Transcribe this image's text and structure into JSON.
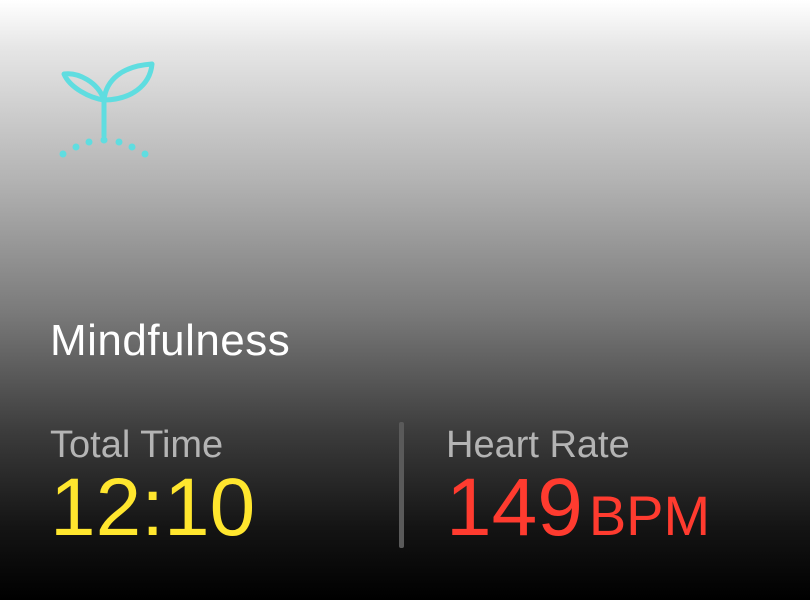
{
  "workout": {
    "icon": "sprout-icon",
    "icon_color": "#5fdde0",
    "title": "Mindfulness"
  },
  "metrics": {
    "total_time": {
      "label": "Total Time",
      "value": "12:10",
      "color": "#ffe62e"
    },
    "heart_rate": {
      "label": "Heart Rate",
      "value": "149",
      "unit": "BPM",
      "color": "#ff3b2f"
    }
  }
}
